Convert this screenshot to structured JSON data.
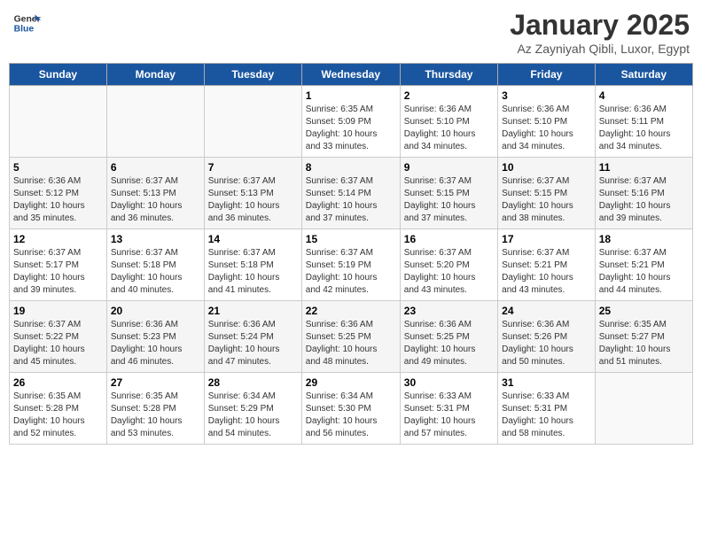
{
  "logo": {
    "line1": "General",
    "line2": "Blue"
  },
  "title": "January 2025",
  "subtitle": "Az Zayniyah Qibli, Luxor, Egypt",
  "weekdays": [
    "Sunday",
    "Monday",
    "Tuesday",
    "Wednesday",
    "Thursday",
    "Friday",
    "Saturday"
  ],
  "weeks": [
    [
      {
        "day": "",
        "detail": ""
      },
      {
        "day": "",
        "detail": ""
      },
      {
        "day": "",
        "detail": ""
      },
      {
        "day": "1",
        "detail": "Sunrise: 6:35 AM\nSunset: 5:09 PM\nDaylight: 10 hours\nand 33 minutes."
      },
      {
        "day": "2",
        "detail": "Sunrise: 6:36 AM\nSunset: 5:10 PM\nDaylight: 10 hours\nand 34 minutes."
      },
      {
        "day": "3",
        "detail": "Sunrise: 6:36 AM\nSunset: 5:10 PM\nDaylight: 10 hours\nand 34 minutes."
      },
      {
        "day": "4",
        "detail": "Sunrise: 6:36 AM\nSunset: 5:11 PM\nDaylight: 10 hours\nand 34 minutes."
      }
    ],
    [
      {
        "day": "5",
        "detail": "Sunrise: 6:36 AM\nSunset: 5:12 PM\nDaylight: 10 hours\nand 35 minutes."
      },
      {
        "day": "6",
        "detail": "Sunrise: 6:37 AM\nSunset: 5:13 PM\nDaylight: 10 hours\nand 36 minutes."
      },
      {
        "day": "7",
        "detail": "Sunrise: 6:37 AM\nSunset: 5:13 PM\nDaylight: 10 hours\nand 36 minutes."
      },
      {
        "day": "8",
        "detail": "Sunrise: 6:37 AM\nSunset: 5:14 PM\nDaylight: 10 hours\nand 37 minutes."
      },
      {
        "day": "9",
        "detail": "Sunrise: 6:37 AM\nSunset: 5:15 PM\nDaylight: 10 hours\nand 37 minutes."
      },
      {
        "day": "10",
        "detail": "Sunrise: 6:37 AM\nSunset: 5:15 PM\nDaylight: 10 hours\nand 38 minutes."
      },
      {
        "day": "11",
        "detail": "Sunrise: 6:37 AM\nSunset: 5:16 PM\nDaylight: 10 hours\nand 39 minutes."
      }
    ],
    [
      {
        "day": "12",
        "detail": "Sunrise: 6:37 AM\nSunset: 5:17 PM\nDaylight: 10 hours\nand 39 minutes."
      },
      {
        "day": "13",
        "detail": "Sunrise: 6:37 AM\nSunset: 5:18 PM\nDaylight: 10 hours\nand 40 minutes."
      },
      {
        "day": "14",
        "detail": "Sunrise: 6:37 AM\nSunset: 5:18 PM\nDaylight: 10 hours\nand 41 minutes."
      },
      {
        "day": "15",
        "detail": "Sunrise: 6:37 AM\nSunset: 5:19 PM\nDaylight: 10 hours\nand 42 minutes."
      },
      {
        "day": "16",
        "detail": "Sunrise: 6:37 AM\nSunset: 5:20 PM\nDaylight: 10 hours\nand 43 minutes."
      },
      {
        "day": "17",
        "detail": "Sunrise: 6:37 AM\nSunset: 5:21 PM\nDaylight: 10 hours\nand 43 minutes."
      },
      {
        "day": "18",
        "detail": "Sunrise: 6:37 AM\nSunset: 5:21 PM\nDaylight: 10 hours\nand 44 minutes."
      }
    ],
    [
      {
        "day": "19",
        "detail": "Sunrise: 6:37 AM\nSunset: 5:22 PM\nDaylight: 10 hours\nand 45 minutes."
      },
      {
        "day": "20",
        "detail": "Sunrise: 6:36 AM\nSunset: 5:23 PM\nDaylight: 10 hours\nand 46 minutes."
      },
      {
        "day": "21",
        "detail": "Sunrise: 6:36 AM\nSunset: 5:24 PM\nDaylight: 10 hours\nand 47 minutes."
      },
      {
        "day": "22",
        "detail": "Sunrise: 6:36 AM\nSunset: 5:25 PM\nDaylight: 10 hours\nand 48 minutes."
      },
      {
        "day": "23",
        "detail": "Sunrise: 6:36 AM\nSunset: 5:25 PM\nDaylight: 10 hours\nand 49 minutes."
      },
      {
        "day": "24",
        "detail": "Sunrise: 6:36 AM\nSunset: 5:26 PM\nDaylight: 10 hours\nand 50 minutes."
      },
      {
        "day": "25",
        "detail": "Sunrise: 6:35 AM\nSunset: 5:27 PM\nDaylight: 10 hours\nand 51 minutes."
      }
    ],
    [
      {
        "day": "26",
        "detail": "Sunrise: 6:35 AM\nSunset: 5:28 PM\nDaylight: 10 hours\nand 52 minutes."
      },
      {
        "day": "27",
        "detail": "Sunrise: 6:35 AM\nSunset: 5:28 PM\nDaylight: 10 hours\nand 53 minutes."
      },
      {
        "day": "28",
        "detail": "Sunrise: 6:34 AM\nSunset: 5:29 PM\nDaylight: 10 hours\nand 54 minutes."
      },
      {
        "day": "29",
        "detail": "Sunrise: 6:34 AM\nSunset: 5:30 PM\nDaylight: 10 hours\nand 56 minutes."
      },
      {
        "day": "30",
        "detail": "Sunrise: 6:33 AM\nSunset: 5:31 PM\nDaylight: 10 hours\nand 57 minutes."
      },
      {
        "day": "31",
        "detail": "Sunrise: 6:33 AM\nSunset: 5:31 PM\nDaylight: 10 hours\nand 58 minutes."
      },
      {
        "day": "",
        "detail": ""
      }
    ]
  ]
}
